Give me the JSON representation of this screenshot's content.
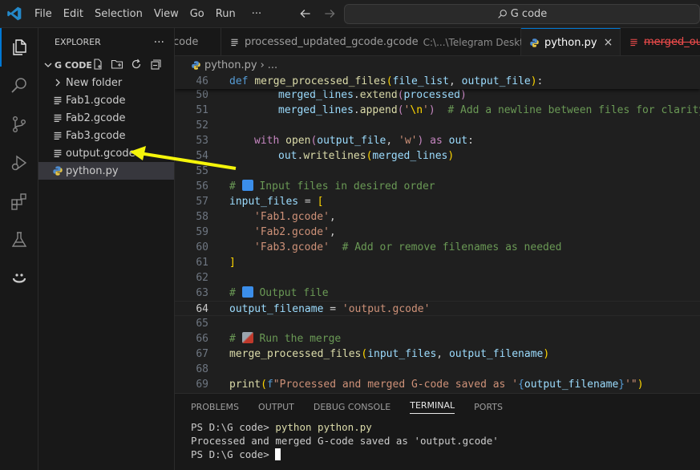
{
  "menu": [
    "File",
    "Edit",
    "Selection",
    "View",
    "Go",
    "Run",
    "···"
  ],
  "search": {
    "text": "G code"
  },
  "activity_icons": [
    "explorer-icon",
    "search-icon",
    "source-control-icon",
    "run-debug-icon",
    "extensions-icon",
    "testing-icon",
    "copilot-icon"
  ],
  "sidebar": {
    "title": "EXPLORER",
    "more": "···",
    "section": "G CODE",
    "items": [
      {
        "label": "New folder",
        "icon": "chevron-right-icon"
      },
      {
        "label": "Fab1.gcode",
        "icon": "file-lines-icon"
      },
      {
        "label": "Fab2.gcode",
        "icon": "file-lines-icon"
      },
      {
        "label": "Fab3.gcode",
        "icon": "file-lines-icon"
      },
      {
        "label": "output.gcode",
        "icon": "file-lines-icon"
      },
      {
        "label": "python.py",
        "icon": "python-icon"
      }
    ]
  },
  "tabs": [
    {
      "label": "code"
    },
    {
      "label": "processed_updated_gcode.gcode",
      "desc": "C:\\...\\Telegram Desktop"
    },
    {
      "label": "python.py",
      "close": "×"
    },
    {
      "label": "merged_out"
    }
  ],
  "breadcrumb": {
    "file": "python.py",
    "sep": "›",
    "rest": "..."
  },
  "code_lines": [
    {
      "n": "46",
      "code": "def merge_processed_files(file_list, output_file):"
    },
    {
      "n": "50",
      "code": "merged_lines.extend(processed)"
    },
    {
      "n": "51",
      "code": "merged_lines.append('\\n')  # Add a newline between files for clarity"
    },
    {
      "n": "52",
      "code": ""
    },
    {
      "n": "53",
      "code": "with open(output_file, 'w') as out:"
    },
    {
      "n": "54",
      "code": "out.writelines(merged_lines)"
    },
    {
      "n": "55",
      "code": ""
    },
    {
      "n": "56",
      "code": "# 🔽 Input files in desired order"
    },
    {
      "n": "57",
      "code": "input_files = ["
    },
    {
      "n": "58",
      "code": "'Fab1.gcode',"
    },
    {
      "n": "59",
      "code": "'Fab2.gcode',"
    },
    {
      "n": "60",
      "code": "'Fab3.gcode'  # Add or remove filenames as needed"
    },
    {
      "n": "61",
      "code": "]"
    },
    {
      "n": "62",
      "code": ""
    },
    {
      "n": "63",
      "code": "# 🔼 Output file"
    },
    {
      "n": "64",
      "code": "output_filename = 'output.gcode'"
    },
    {
      "n": "65",
      "code": ""
    },
    {
      "n": "66",
      "code": "# 🛠️ Run the merge"
    },
    {
      "n": "67",
      "code": "merge_processed_files(input_files, output_filename)"
    },
    {
      "n": "68",
      "code": ""
    },
    {
      "n": "69",
      "code": "print(f\"Processed and merged G-code saved as '{output_filename}'\")"
    }
  ],
  "panel": {
    "tabs": [
      "PROBLEMS",
      "OUTPUT",
      "DEBUG CONSOLE",
      "TERMINAL",
      "PORTS"
    ],
    "active_tab": "TERMINAL",
    "terminal": {
      "prompt": "PS D:\\G code> ",
      "command": "python python.py",
      "output": "Processed and merged G-code saved as 'output.gcode'"
    }
  },
  "colors": {
    "accent": "#0078d4",
    "arrow": "#f5f50a",
    "deleted_tab": "#f14c4c"
  }
}
